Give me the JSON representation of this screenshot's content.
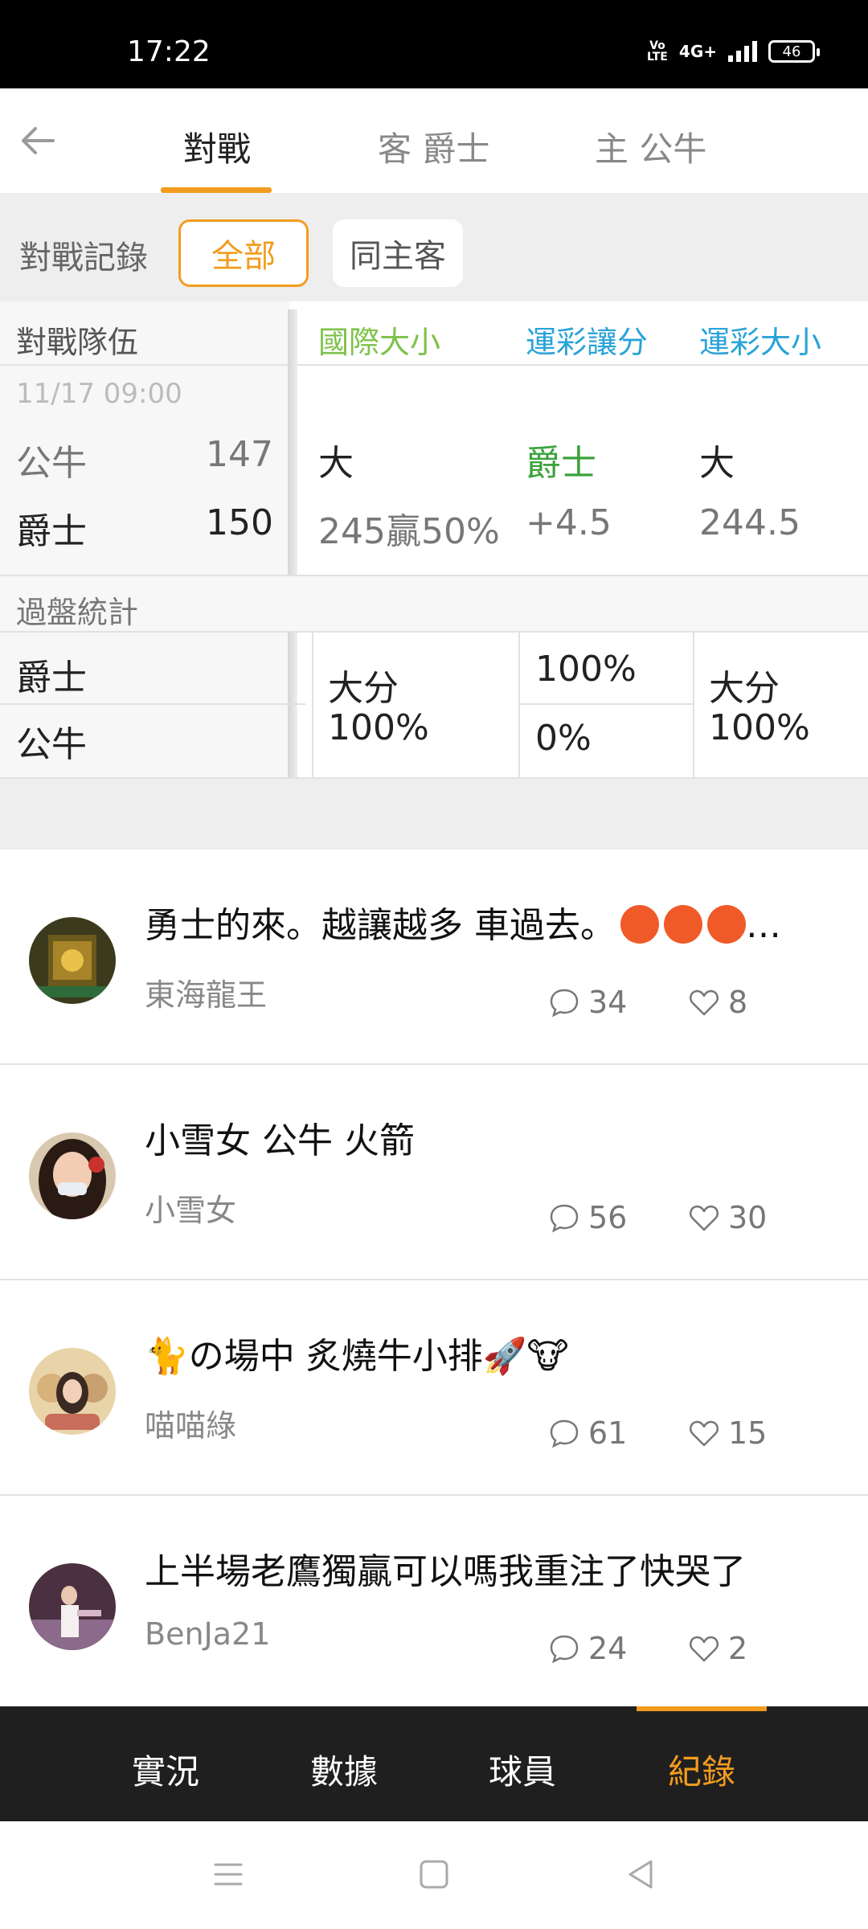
{
  "status_bar": {
    "time": "17:22",
    "volte": "Vo LTE",
    "network": "4G+",
    "battery": "46"
  },
  "header": {
    "back_icon": "arrow-left-icon",
    "tabs": [
      {
        "label": "對戰",
        "active": true
      },
      {
        "label": "客 爵士",
        "active": false
      },
      {
        "label": "主 公牛",
        "active": false
      }
    ]
  },
  "filter": {
    "label": "對戰記錄",
    "chips": [
      "全部",
      "同主客"
    ],
    "selected": "全部"
  },
  "table": {
    "team_header": "對戰隊伍",
    "columns": [
      "國際大小",
      "運彩讓分",
      "運彩大小"
    ],
    "column_colors": [
      "#7ec24a",
      "#2aa3d8",
      "#2aa3d8"
    ],
    "game": {
      "datetime": "11/17 09:00",
      "rows": [
        {
          "team": "公牛",
          "score": "147",
          "c1": "大",
          "c2": "爵士",
          "c3": "大"
        },
        {
          "team": "爵士",
          "score": "150",
          "c1": "245贏50%",
          "c2": "+4.5",
          "c3": "244.5"
        }
      ]
    },
    "stats": {
      "title": "過盤統計",
      "teams": [
        "爵士",
        "公牛"
      ],
      "c1": [
        "大分",
        "100%"
      ],
      "c2_top": "100%",
      "c2_bottom": "0%",
      "c3": [
        "大分",
        "100%"
      ]
    }
  },
  "posts": [
    {
      "title": "勇士的來。越讓越多 車過去。",
      "emoji": "angry-face-icon",
      "ellipsis": "…",
      "user": "東海龍王",
      "comments": "34",
      "likes": "8"
    },
    {
      "title": "小雪女 公牛 火箭",
      "user": "小雪女",
      "comments": "56",
      "likes": "30"
    },
    {
      "title": "🐈の場中 炙燒牛小排🚀🐮",
      "user": "喵喵綠",
      "comments": "61",
      "likes": "15"
    },
    {
      "title": "上半場老鷹獨贏可以嗎我重注了快哭了",
      "user": "BenJa21",
      "comments": "24",
      "likes": "2"
    }
  ],
  "bottom_nav": {
    "items": [
      "實況",
      "數據",
      "球員",
      "紀錄"
    ],
    "active": "紀錄",
    "accent": "#f29c1f"
  },
  "system_nav": {
    "icons": [
      "menu-icon",
      "home-square-icon",
      "back-triangle-icon"
    ]
  }
}
